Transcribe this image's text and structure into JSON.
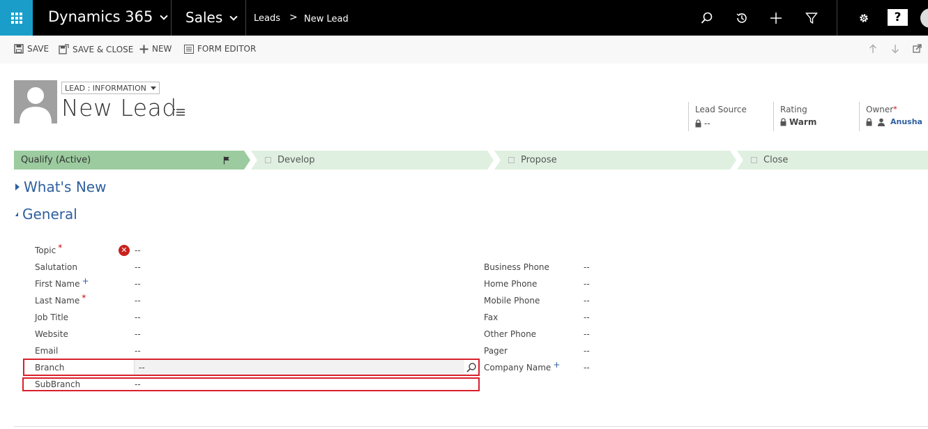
{
  "nav": {
    "app_title": "Dynamics 365",
    "area": "Sales",
    "breadcrumb": [
      "Leads",
      "New Lead"
    ],
    "breadcrumb_sep": ">",
    "help": "?"
  },
  "commands": {
    "save": "SAVE",
    "save_close": "SAVE & CLOSE",
    "new": "NEW",
    "form_editor": "FORM EDITOR"
  },
  "header": {
    "form_selector": "LEAD : INFORMATION",
    "title": "New Lead",
    "fields": [
      {
        "label": "Lead Source",
        "value": "--"
      },
      {
        "label": "Rating",
        "value": "Warm"
      },
      {
        "label": "Owner",
        "value": "Anusha"
      }
    ]
  },
  "process": {
    "stages": [
      {
        "label": "Qualify (Active)",
        "active": true
      },
      {
        "label": "Develop",
        "active": false
      },
      {
        "label": "Propose",
        "active": false
      },
      {
        "label": "Close",
        "active": false
      }
    ],
    "active_color": "#9bcb9e",
    "inactive_color": "#dff0e0"
  },
  "sections": {
    "whats_new": "What's New",
    "general": "General"
  },
  "left_fields": [
    {
      "label": "Topic",
      "value": "--",
      "marker": "*"
    },
    {
      "label": "Salutation",
      "value": "--",
      "marker": ""
    },
    {
      "label": "First Name",
      "value": "--",
      "marker": "+"
    },
    {
      "label": "Last Name",
      "value": "--",
      "marker": "*"
    },
    {
      "label": "Job Title",
      "value": "--",
      "marker": ""
    },
    {
      "label": "Website",
      "value": "--",
      "marker": ""
    },
    {
      "label": "Email",
      "value": "--",
      "marker": ""
    },
    {
      "label": "Branch",
      "value": "--",
      "marker": ""
    },
    {
      "label": "SubBranch",
      "value": "--",
      "marker": ""
    }
  ],
  "right_fields": [
    {
      "label": "Business Phone",
      "value": "--",
      "marker": ""
    },
    {
      "label": "Home Phone",
      "value": "--",
      "marker": ""
    },
    {
      "label": "Mobile Phone",
      "value": "--",
      "marker": ""
    },
    {
      "label": "Fax",
      "value": "--",
      "marker": ""
    },
    {
      "label": "Other Phone",
      "value": "--",
      "marker": ""
    },
    {
      "label": "Pager",
      "value": "--",
      "marker": ""
    },
    {
      "label": "Company Name",
      "value": "--",
      "marker": "+"
    }
  ],
  "colors": {
    "accent": "#1a9ec9",
    "section_heading": "#2e5f9e",
    "highlight_border": "#d9202a",
    "required": "#c00"
  }
}
